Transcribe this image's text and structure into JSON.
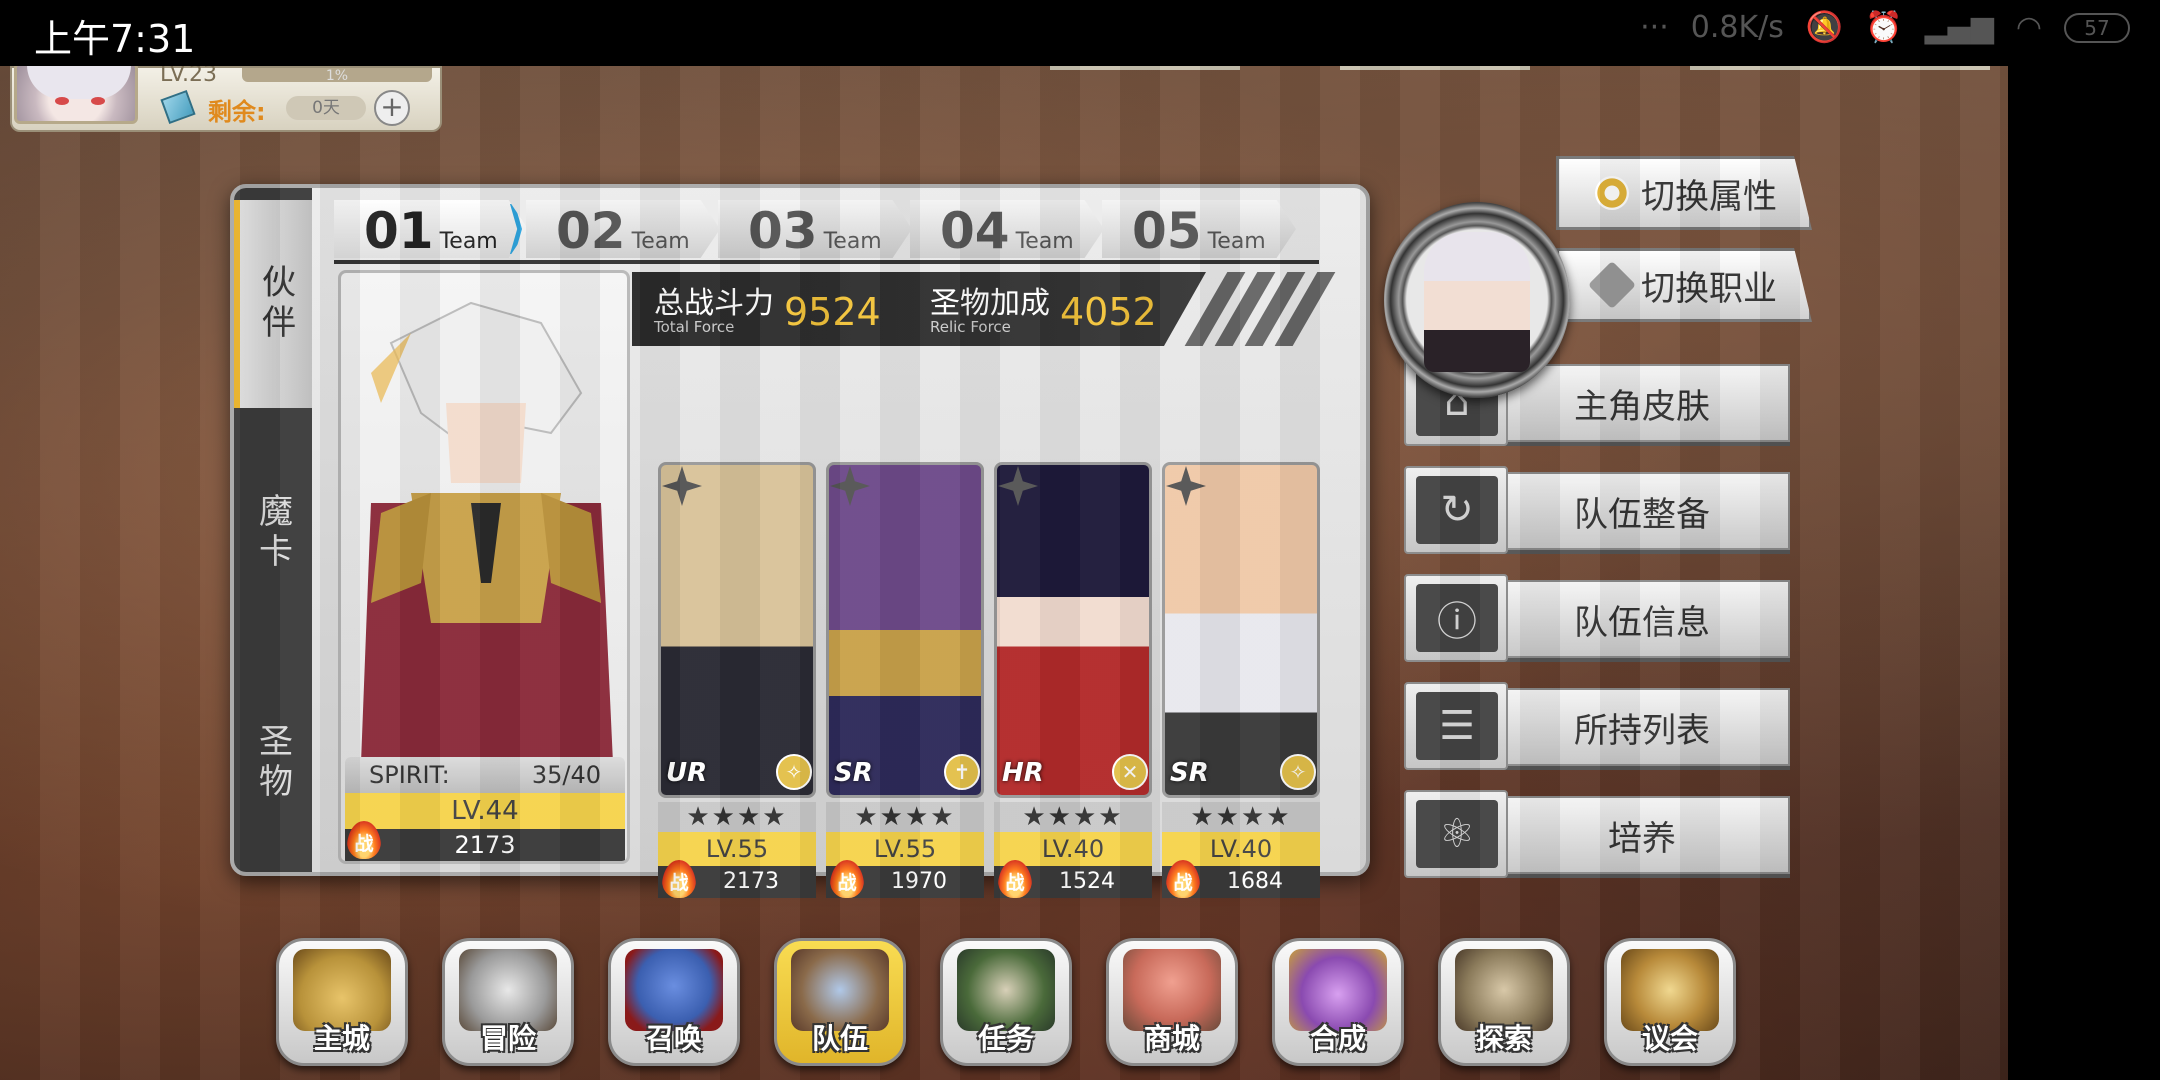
{
  "status_bar": {
    "time": "上午7:31",
    "network_speed": "0.8K/s",
    "battery": "57",
    "icons": [
      "more-icon",
      "mute-icon",
      "alarm-icon",
      "signal-icon",
      "wifi-icon",
      "battery-icon"
    ]
  },
  "player": {
    "level": "LV.23",
    "exp": "1%",
    "remaining_label": "剩余:",
    "remaining_value": "0天"
  },
  "side_tabs": [
    {
      "label": "伙伴",
      "active": true
    },
    {
      "label": "魔卡",
      "active": false
    },
    {
      "label": "圣物",
      "active": false
    }
  ],
  "team_tabs": [
    {
      "num": "01",
      "label": "Team",
      "active": true
    },
    {
      "num": "02",
      "label": "Team",
      "active": false
    },
    {
      "num": "03",
      "label": "Team",
      "active": false
    },
    {
      "num": "04",
      "label": "Team",
      "active": false
    },
    {
      "num": "05",
      "label": "Team",
      "active": false
    }
  ],
  "force": {
    "total_cn": "总战斗力",
    "total_en": "Total Force",
    "total_value": "9524",
    "relic_cn": "圣物加成",
    "relic_en": "Relic Force",
    "relic_value": "4052"
  },
  "leader": {
    "spirit_label": "SPIRIT:",
    "spirit_value": "35/40",
    "level": "LV.44",
    "power": "2173",
    "power_badge": "战"
  },
  "members": [
    {
      "rarity": "UR",
      "stars": "★★★★",
      "level": "LV.55",
      "power": "2173",
      "class_icon": "wrench-icon",
      "color_top": "#d9c39a",
      "color_bottom": "#2a2a34"
    },
    {
      "rarity": "SR",
      "stars": "★★★★",
      "level": "LV.55",
      "power": "1970",
      "class_icon": "cross-icon",
      "color_top": "#6e4a8a",
      "color_bottom": "#2e2a5a"
    },
    {
      "rarity": "HR",
      "stars": "★★★★",
      "level": "LV.40",
      "power": "1524",
      "class_icon": "crossed-icon",
      "color_top": "#1e1a3a",
      "color_bottom": "#b32a2a"
    },
    {
      "rarity": "SR",
      "stars": "★★★★",
      "level": "LV.40",
      "power": "1684",
      "class_icon": "wrench-icon",
      "color_top": "#f0c9a8",
      "color_bottom": "#e8e8ee"
    }
  ],
  "switch_buttons": [
    {
      "label": "切换属性",
      "icon": "gear-icon"
    },
    {
      "label": "切换职业",
      "icon": "swords-icon"
    }
  ],
  "menu_buttons": [
    {
      "label": "主角皮肤",
      "icon": "hanger-icon",
      "glyph": "⌂"
    },
    {
      "label": "队伍整备",
      "icon": "cycle-icon",
      "glyph": "↻"
    },
    {
      "label": "队伍信息",
      "icon": "team-info-icon",
      "glyph": "ⓘ"
    },
    {
      "label": "所持列表",
      "icon": "list-icon",
      "glyph": "☰"
    },
    {
      "label": "培养",
      "icon": "train-icon",
      "glyph": "⚛"
    }
  ],
  "bottom_nav": [
    {
      "label": "主城",
      "icon": "crown-icon",
      "active": false,
      "color": "#b8923a"
    },
    {
      "label": "冒险",
      "icon": "axe-shield-icon",
      "active": false,
      "color": "#9a9a9a"
    },
    {
      "label": "召唤",
      "icon": "summon-card-icon",
      "active": false,
      "color": "#3b5fb0"
    },
    {
      "label": "队伍",
      "icon": "winged-shield-icon",
      "active": true,
      "color": "#8a6a4a"
    },
    {
      "label": "任务",
      "icon": "book-icon",
      "active": false,
      "color": "#4a6a3a"
    },
    {
      "label": "商城",
      "icon": "mushroom-icon",
      "active": false,
      "color": "#c86a5a"
    },
    {
      "label": "合成",
      "icon": "potion-icon",
      "active": false,
      "color": "#8a4ab0"
    },
    {
      "label": "探索",
      "icon": "shovel-icon",
      "active": false,
      "color": "#8a7a5a"
    },
    {
      "label": "议会",
      "icon": "council-emblem-icon",
      "active": false,
      "color": "#b88a3a"
    }
  ]
}
